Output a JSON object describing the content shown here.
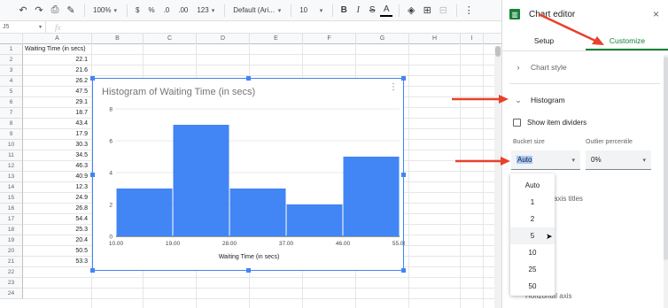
{
  "toolbar": {
    "zoom": "100%",
    "currency": "$",
    "percent": "%",
    "decimal_less": ".0",
    "decimal_more": ".00",
    "format_more": "123",
    "font": "Default (Ari...",
    "font_size": "10",
    "bold": "B",
    "italic": "I",
    "strike": "S",
    "text_color": "A"
  },
  "formula_bar": {
    "cell_ref": "J5",
    "fx": "fx"
  },
  "grid": {
    "columns": [
      "A",
      "B",
      "C",
      "D",
      "E",
      "F",
      "G",
      "H",
      "I"
    ],
    "rows": [
      "1",
      "2",
      "3",
      "4",
      "5",
      "6",
      "7",
      "8",
      "9",
      "10",
      "11",
      "12",
      "13",
      "14",
      "15",
      "16",
      "17",
      "18",
      "19",
      "20",
      "21",
      "22",
      "23",
      "24"
    ],
    "col_a_header": "Waiting Time (in secs)",
    "col_a_values": [
      "22.1",
      "21.6",
      "26.2",
      "47.5",
      "29.1",
      "18.7",
      "43.4",
      "17.9",
      "30.3",
      "34.5",
      "46.3",
      "40.9",
      "12.3",
      "24.9",
      "26.8",
      "54.4",
      "25.3",
      "20.4",
      "50.5",
      "53.3"
    ]
  },
  "chart_data": {
    "type": "bar",
    "title": "Histogram of Waiting Time (in secs)",
    "xlabel": "Waiting Time (in secs)",
    "ylabel": "",
    "categories": [
      "10.00-19.00",
      "19.00-28.00",
      "28.00-37.00",
      "37.00-46.00",
      "46.00-55.00"
    ],
    "x_ticks": [
      "10.00",
      "19.00",
      "28.00",
      "37.00",
      "46.00",
      "55.00"
    ],
    "y_ticks": [
      "0",
      "2",
      "4",
      "6",
      "8"
    ],
    "values": [
      3,
      7,
      3,
      2,
      5
    ],
    "ylim": [
      0,
      8
    ],
    "grid": true,
    "color": "#4285f4"
  },
  "panel": {
    "title": "Chart editor",
    "close": "×",
    "tabs": [
      {
        "label": "Setup"
      },
      {
        "label": "Customize"
      }
    ],
    "chart_style": "Chart style",
    "histogram": "Histogram",
    "show_dividers": "Show item dividers",
    "bucket_label": "Bucket size",
    "bucket_value": "Auto",
    "outlier_label": "Outlier percentile",
    "outlier_value": "0%",
    "axis_titles_partial": "axis titles",
    "horizontal_axis_partial": "Horizontal axis"
  },
  "dropdown": {
    "options": [
      "Auto",
      "1",
      "2",
      "5",
      "10",
      "25",
      "50"
    ],
    "hovered": "5"
  },
  "colors": {
    "accent_green": "#188038",
    "chart_blue": "#4285f4",
    "annotation_red": "#e8412c"
  }
}
